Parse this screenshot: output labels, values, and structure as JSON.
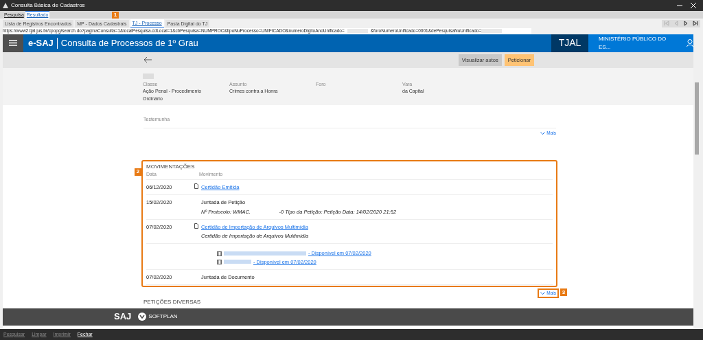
{
  "window": {
    "title": "Consulta Básica de Cadastros"
  },
  "tabs": [
    {
      "label": "Pesquisa",
      "selected": false
    },
    {
      "label": "Resultado",
      "selected": true
    }
  ],
  "subtabs": [
    {
      "label": "Lista de Registros Encontrados",
      "selected": false
    },
    {
      "label": "MP - Dados Cadastrais",
      "selected": false
    },
    {
      "label": "TJ - Processo",
      "selected": true
    },
    {
      "label": "Pasta Digital do TJ",
      "selected": false
    }
  ],
  "nav_buttons": [
    {
      "kind": "first",
      "disabled": true
    },
    {
      "kind": "previous",
      "disabled": true
    },
    {
      "kind": "next",
      "disabled": false
    },
    {
      "kind": "last",
      "disabled": false
    }
  ],
  "url": {
    "part_1": "https://www2.tjal.jus.br/cpopg/search.do?paginaConsulta=1&localPesquisa.cdLocal=1&cbPesquisa=NUMPROC&tipoNuProcesso=UNIFICADO&numeroDigitoAnoUnificado=",
    "part_2": "&foroNumeroUnificado=0001&dePesquisaNuUnificado="
  },
  "header": {
    "brand": "e-SAJ",
    "title": "Consulta de Processos de 1º Grau",
    "court": "TJAL",
    "user": "MINISTÉRIO PÚBLICO DO ES..."
  },
  "toolbar": {
    "buttons": [
      {
        "label": "Visualizar autos",
        "kind": "secondary"
      },
      {
        "label": "Peticionar",
        "kind": "primary"
      }
    ]
  },
  "details": [
    {
      "label": "Classe",
      "lines": [
        "Ação Penal - Procedimento",
        "Ordinário"
      ]
    },
    {
      "label": "Assunto",
      "lines": [
        "Crimes contra a Honra"
      ]
    },
    {
      "label": "Foro"
    },
    {
      "label": "Vara",
      "lines": [
        "da Capital"
      ]
    }
  ],
  "parties": {
    "label": "Testemunha",
    "more": "Mais"
  },
  "movements": {
    "title": "MOVIMENTAÇÕES",
    "columns": [
      "Data",
      "Movimento"
    ],
    "more": "Mais",
    "rows": [
      {
        "kind": "document",
        "date": "06/12/2020",
        "text": "Certidão Emitida"
      },
      {
        "kind": "entry",
        "date": "15/02/2020",
        "text": "Juntada de Petição",
        "detail": "Nº Protocolo: WMAC.                    -0 Tipo da Petição: Petição Data: 14/02/2020 21:52"
      },
      {
        "kind": "document",
        "date": "07/02/2020",
        "text": "Certidão de Importação de Arquivos Multimídia",
        "detail": "Certidão de Importação de Arquivos Multimídia"
      },
      {
        "kind": "files",
        "files": [
          "- Disponível em 07/02/2020",
          "- Disponível em 07/02/2020"
        ]
      },
      {
        "kind": "entry",
        "date": "07/02/2020",
        "text": "Juntada de Documento"
      }
    ]
  },
  "next_section": {
    "title": "PETIÇÕES DIVERSAS"
  },
  "footer": {
    "logo_1": "SAJ",
    "logo_2": "SOFTPLAN"
  },
  "bottom_buttons": [
    {
      "label": "Pesquisar",
      "disabled": true
    },
    {
      "label": "Limpar",
      "disabled": true
    },
    {
      "label": "Imprimir",
      "disabled": true
    },
    {
      "label": "Fechar",
      "disabled": false
    }
  ],
  "annotations": [
    {
      "label": "1"
    },
    {
      "label": "2"
    },
    {
      "label": "3"
    }
  ]
}
